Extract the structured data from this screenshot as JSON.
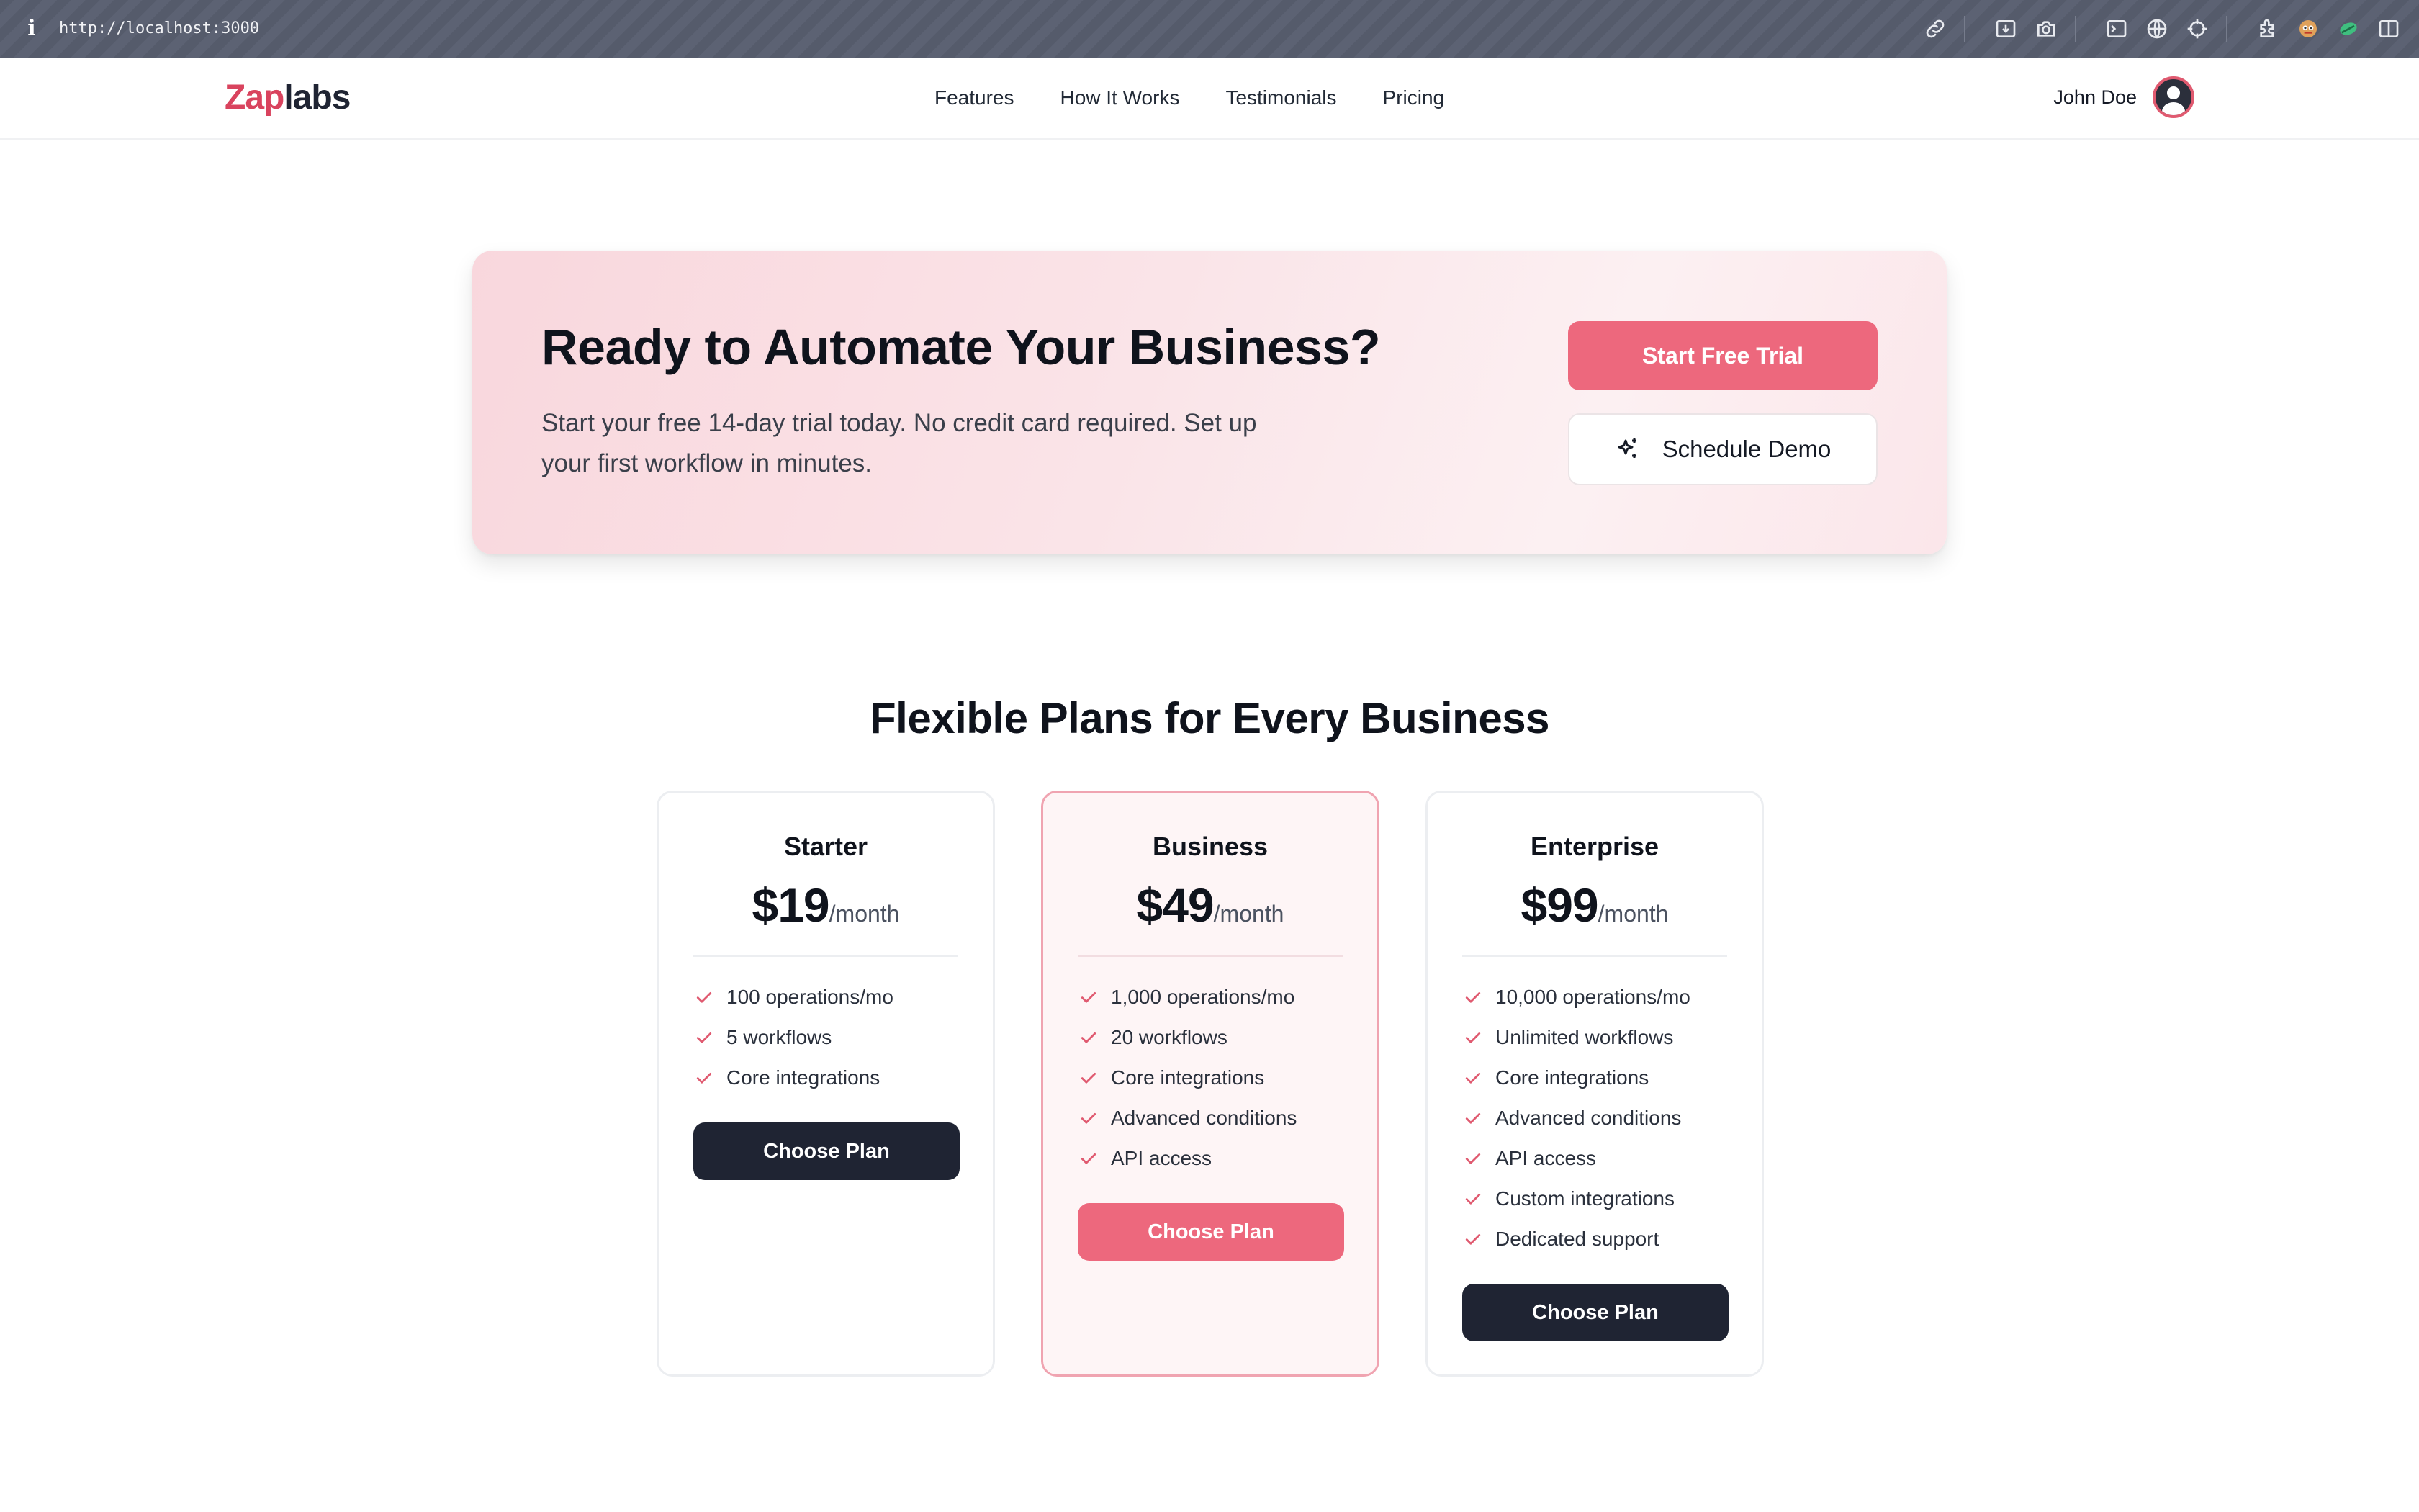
{
  "browser": {
    "url": "http://localhost:3000",
    "icons": [
      "link-icon",
      "download-icon",
      "camera-icon",
      "terminal-icon",
      "globe-icon",
      "crosshair-icon",
      "extension-icon",
      "extension-avatar-icon",
      "extension-leaf-icon",
      "sidebar-icon"
    ]
  },
  "nav": {
    "logo_part1": "Zap",
    "logo_part2": "labs",
    "links": [
      "Features",
      "How It Works",
      "Testimonials",
      "Pricing"
    ],
    "user_name": "John Doe"
  },
  "cta": {
    "title": "Ready to Automate Your Business?",
    "subtitle": "Start your free 14-day trial today. No credit card required. Set up your first workflow in minutes.",
    "primary_label": "Start Free Trial",
    "secondary_label": "Schedule Demo",
    "secondary_icon": "sparkles-icon"
  },
  "pricing": {
    "title": "Flexible Plans for Every Business",
    "plans": [
      {
        "name": "Starter",
        "price": "$19",
        "period": "/month",
        "features": [
          "100 operations/mo",
          "5 workflows",
          "Core integrations"
        ],
        "button": "Choose Plan",
        "featured": false
      },
      {
        "name": "Business",
        "price": "$49",
        "period": "/month",
        "features": [
          "1,000 operations/mo",
          "20 workflows",
          "Core integrations",
          "Advanced conditions",
          "API access"
        ],
        "button": "Choose Plan",
        "featured": true
      },
      {
        "name": "Enterprise",
        "price": "$99",
        "period": "/month",
        "features": [
          "10,000 operations/mo",
          "Unlimited workflows",
          "Core integrations",
          "Advanced conditions",
          "API access",
          "Custom integrations",
          "Dedicated support"
        ],
        "button": "Choose Plan",
        "featured": false
      }
    ]
  },
  "colors": {
    "brand": "#d9435e",
    "accent_button": "#ed687d",
    "dark_button": "#1f2433",
    "check": "#e05a70"
  }
}
